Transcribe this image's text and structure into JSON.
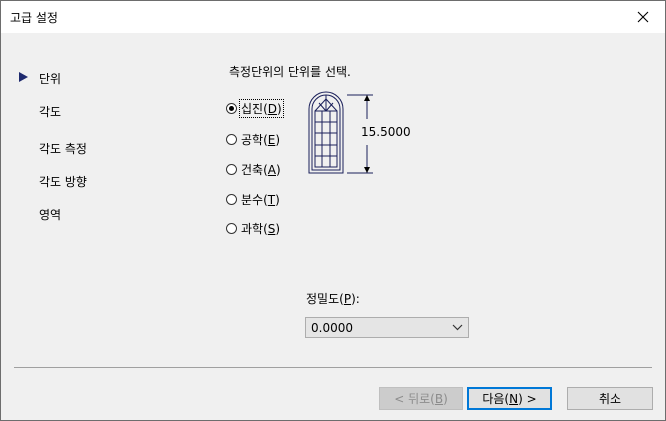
{
  "window": {
    "title": "고급 설정"
  },
  "nav": {
    "items": [
      {
        "label": "단위",
        "selected": true
      },
      {
        "label": "각도",
        "selected": false
      },
      {
        "label": "각도 측정",
        "selected": false
      },
      {
        "label": "각도 방향",
        "selected": false
      },
      {
        "label": "영역",
        "selected": false
      }
    ]
  },
  "main": {
    "prompt": "측정단위의 단위를 선택.",
    "options": [
      {
        "label": "십진",
        "key": "D",
        "selected": true
      },
      {
        "label": "공학",
        "key": "E",
        "selected": false
      },
      {
        "label": "건축",
        "key": "A",
        "selected": false
      },
      {
        "label": "분수",
        "key": "T",
        "selected": false
      },
      {
        "label": "과학",
        "key": "S",
        "selected": false
      }
    ],
    "dimension": "15.5000",
    "precision": {
      "label": "정밀도",
      "key": "P",
      "value": "0.0000"
    }
  },
  "buttons": {
    "back": {
      "label": "< 뒤로",
      "key": "B"
    },
    "next": {
      "label": "다음",
      "key": "N",
      "suffix": " >"
    },
    "cancel": {
      "label": "취소"
    }
  },
  "icons": {
    "close": "close-icon",
    "dropdown": "chevron-down-icon",
    "nav": "triangle-right-icon"
  }
}
